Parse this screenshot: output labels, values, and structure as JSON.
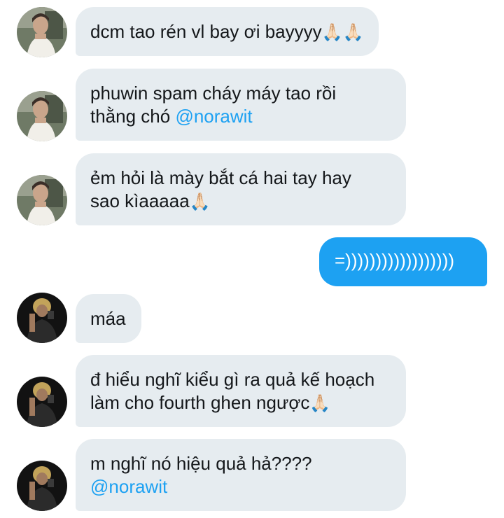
{
  "colors": {
    "incoming_bubble": "#e6ecf0",
    "outgoing_bubble": "#1da1f2",
    "mention": "#1da1f2",
    "text": "#14171a"
  },
  "messages": [
    {
      "direction": "incoming",
      "avatar": "avatar-user-a",
      "lines": [
        "dcm tao rén vl bay ơi bayyyy"
      ],
      "emoji": "🙏🏻🙏🏻"
    },
    {
      "direction": "incoming",
      "avatar": "avatar-user-a",
      "lines": [
        "phuwin spam cháy máy tao rồi",
        "thằng chó "
      ],
      "mention": "@norawit"
    },
    {
      "direction": "incoming",
      "avatar": "avatar-user-a",
      "lines": [
        "ẻm hỏi là mày bắt cá hai tay hay",
        "sao kìaaaaa"
      ],
      "emoji": "🙏🏻"
    },
    {
      "direction": "outgoing",
      "lines": [
        "=))))))))))))))))))"
      ]
    },
    {
      "direction": "incoming",
      "avatar": "avatar-user-b",
      "lines": [
        "máa"
      ]
    },
    {
      "direction": "incoming",
      "avatar": "avatar-user-b",
      "lines": [
        "đ hiểu nghĩ kiểu gì ra quả kế hoạch",
        "làm cho fourth ghen ngược"
      ],
      "emoji": "🙏🏻"
    },
    {
      "direction": "incoming",
      "avatar": "avatar-user-b",
      "lines": [
        "m nghĩ nó hiệu quả hả????"
      ],
      "mention": "@norawit"
    }
  ]
}
